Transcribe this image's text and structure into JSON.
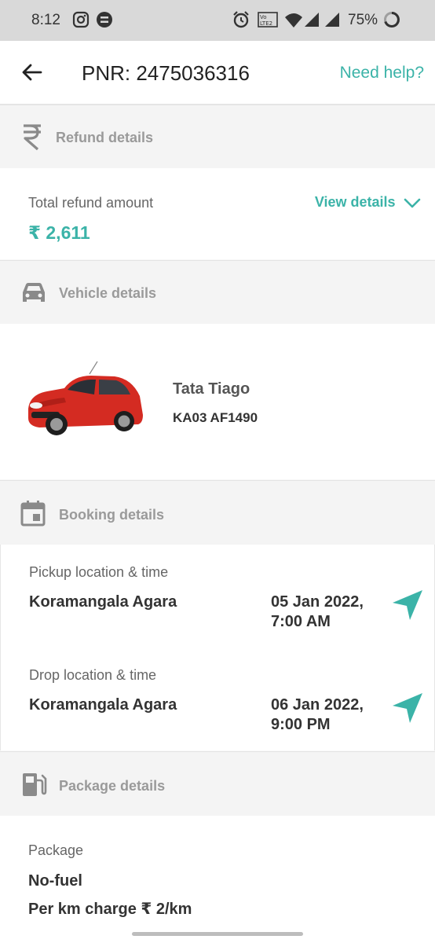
{
  "status_bar": {
    "time": "8:12",
    "battery_percent": "75%",
    "icons": [
      "instagram-icon",
      "app-icon",
      "alarm-icon",
      "volte-icon",
      "wifi-icon",
      "signal-icon",
      "signal-icon-2",
      "battery-ring-icon"
    ]
  },
  "header": {
    "title": "PNR: 2475036316",
    "help_label": "Need help?"
  },
  "refund": {
    "section_label": "Refund details",
    "total_label": "Total refund amount",
    "amount": "₹ 2,611",
    "view_details_label": "View details"
  },
  "vehicle": {
    "section_label": "Vehicle details",
    "name": "Tata Tiago",
    "plate": "KA03 AF1490",
    "car_color": "#d42b22"
  },
  "booking": {
    "section_label": "Booking details",
    "pickup_label": "Pickup location & time",
    "pickup_location": "Koramangala Agara",
    "pickup_date": "05 Jan 2022,",
    "pickup_time": "7:00 AM",
    "drop_label": "Drop location & time",
    "drop_location": "Koramangala Agara",
    "drop_date": "06 Jan 2022,",
    "drop_time": "9:00 PM"
  },
  "package": {
    "section_label": "Package details",
    "label": "Package",
    "fuel": "No-fuel",
    "km_charge": "Per km charge ₹ 2/km"
  },
  "colors": {
    "accent": "#3bb3a8",
    "section_bg": "#f4f4f4",
    "muted_text": "#9a9a9a"
  }
}
